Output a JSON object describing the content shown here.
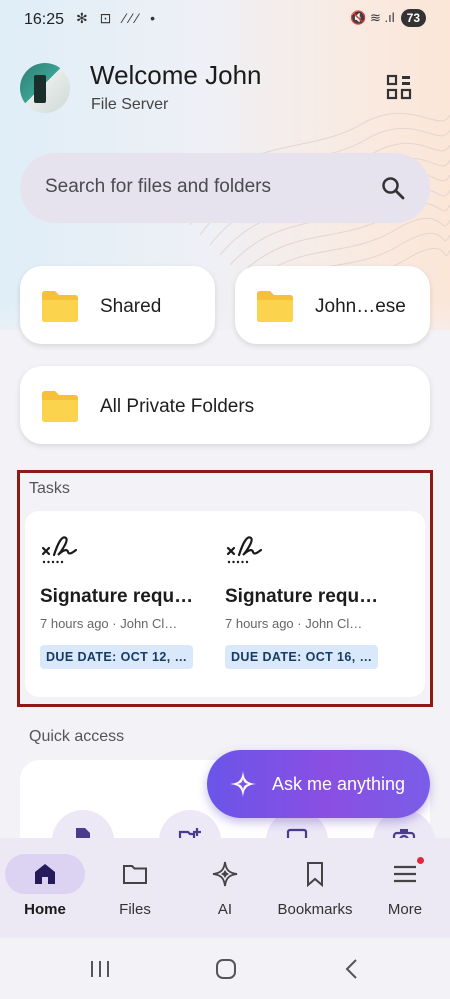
{
  "status_bar": {
    "time": "16:25",
    "left_icons": "✻ ⊡ ⁄⁄⁄ •",
    "right_icons": "🔇 ≋ .ıl",
    "battery": "73"
  },
  "header": {
    "welcome": "Welcome John",
    "subtitle": "File Server"
  },
  "search": {
    "placeholder": "Search for files and folders"
  },
  "folders": [
    {
      "label": "Shared"
    },
    {
      "label": "John…ese"
    },
    {
      "label": "All Private Folders"
    }
  ],
  "tasks": {
    "section_title": "Tasks",
    "items": [
      {
        "title": "Signature requ…",
        "meta": "7 hours ago · John Cl…",
        "due": "DUE DATE: OCT 12, …"
      },
      {
        "title": "Signature requ…",
        "meta": "7 hours ago · John Cl…",
        "due": "DUE DATE: OCT 16, …"
      }
    ]
  },
  "quick_access": {
    "section_title": "Quick access"
  },
  "ask": {
    "label": "Ask me anything"
  },
  "bottom_nav": {
    "items": [
      {
        "label": "Home",
        "icon": "home-icon",
        "active": true
      },
      {
        "label": "Files",
        "icon": "folder-icon"
      },
      {
        "label": "AI",
        "icon": "sparkle-icon"
      },
      {
        "label": "Bookmarks",
        "icon": "bookmark-icon"
      },
      {
        "label": "More",
        "icon": "menu-icon",
        "badge": true
      }
    ]
  },
  "colors": {
    "accent": "#7a55e6",
    "folder": "#fcd34d",
    "task_frame": "#8a1c14",
    "due_badge": "#d9e8fb"
  }
}
